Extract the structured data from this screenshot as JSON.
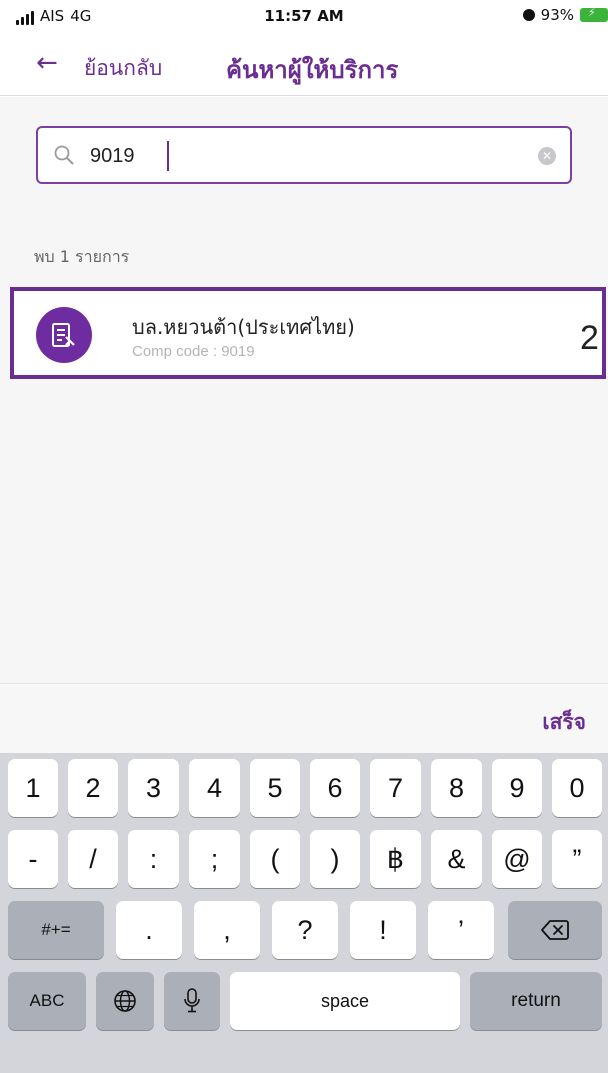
{
  "status_bar": {
    "carrier": "AIS",
    "network": "4G",
    "time": "11:57 AM",
    "battery": "93%"
  },
  "nav": {
    "back_label": "ย้อนกลับ",
    "title": "ค้นหาผู้ให้บริการ"
  },
  "search": {
    "value": "9019"
  },
  "results": {
    "count_label": "พบ 1 รายการ",
    "items": [
      {
        "name": "บล.หยวนต้า(ประเทศไทย)",
        "code": "Comp code : 9019",
        "marker": "2"
      }
    ]
  },
  "keyboard": {
    "done_label": "เสร็จ",
    "row1": [
      "1",
      "2",
      "3",
      "4",
      "5",
      "6",
      "7",
      "8",
      "9",
      "0"
    ],
    "row2": [
      "-",
      "/",
      ":",
      ";",
      "(",
      ")",
      "฿",
      "&",
      "@",
      "”"
    ],
    "row3": {
      "symbols": "#+=",
      "keys": [
        ".",
        ",",
        "?",
        "!",
        "’"
      ]
    },
    "row4": {
      "abc": "ABC",
      "space": "space",
      "return": "return"
    }
  },
  "colors": {
    "accent": "#6a2d91",
    "avatar": "#6f2ca0",
    "battery": "#3cb43c"
  }
}
